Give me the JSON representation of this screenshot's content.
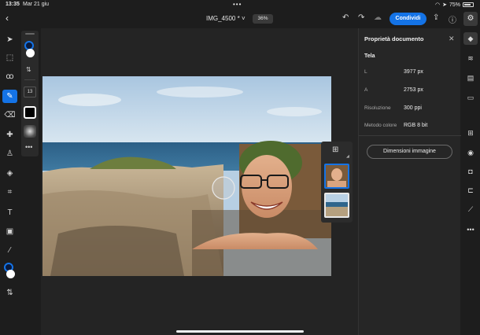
{
  "status_bar": {
    "time": "13:35",
    "date": "Mar 21 giu",
    "battery": "75%"
  },
  "topbar": {
    "title": "IMG_4500 *",
    "zoom": "36%",
    "share_label": "Condividi"
  },
  "left_toolbar": {
    "sub_tool_size": "13"
  },
  "properties": {
    "panel_title": "Proprietà documento",
    "section_title": "Tela",
    "rows": [
      {
        "label": "L",
        "value": "3977 px"
      },
      {
        "label": "A",
        "value": "2753 px"
      },
      {
        "label": "Risoluzione",
        "value": "300 ppi"
      },
      {
        "label": "Metodo colore",
        "value": "RGB  8  bit"
      }
    ],
    "image_size_button": "Dimensioni immagine"
  },
  "colors": {
    "accent": "#1473e6",
    "panel_bg": "#262626",
    "canvas_bg": "#242424"
  }
}
